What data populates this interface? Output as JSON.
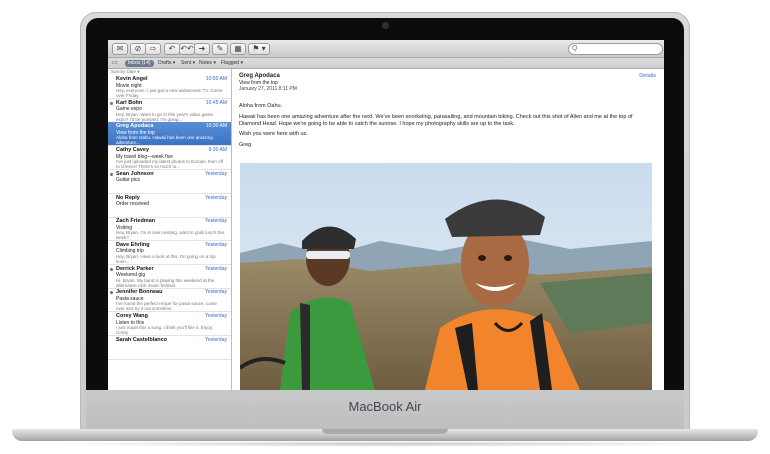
{
  "device_label": "MacBook Air",
  "toolbar": {
    "buttons": [
      "✉",
      "⊘",
      "⇨",
      "↶",
      "↶↶",
      "➜",
      "✎",
      "▦",
      "⚑ ▾"
    ],
    "search_placeholder": "Q"
  },
  "favorites": {
    "inbox": "Inbox (14)",
    "drafts": "Drafts ▾",
    "sent": "Sent ▾",
    "notes": "Notes ▾",
    "flagged": "Flagged ▾"
  },
  "list": {
    "sort_label": "Sort by Date ▾",
    "messages": [
      {
        "sender": "Kevin Angel",
        "date": "10:50 AM",
        "subject": "Movie night",
        "preview": "Hey, everyone. I just got a new widescreen TV. Come over Friday.",
        "unread": false,
        "selected": false
      },
      {
        "sender": "Karl Bohn",
        "date": "10:45 AM",
        "subject": "Game expo",
        "preview": "Hey, Bryan. Want to go to this year's video game expo? I'd be pumped, I'm going...",
        "unread": true,
        "selected": false
      },
      {
        "sender": "Greg Apodaca",
        "date": "10:30 AM",
        "subject": "View from the top",
        "preview": "Aloha from Oahu. Hawaii has been one amazing adventure...",
        "unread": false,
        "selected": true
      },
      {
        "sender": "Cathy Cavey",
        "date": "9:30 AM",
        "subject": "My travel blog—week five",
        "preview": "I've just uploaded my latest photos to Europe, then off to Greece! There's so much to...",
        "unread": false,
        "selected": false
      },
      {
        "sender": "Sean Johnson",
        "date": "Yesterday",
        "subject": "Guitar pics",
        "preview": "",
        "unread": true,
        "selected": false
      },
      {
        "sender": "No Reply",
        "date": "Yesterday",
        "subject": "Order received",
        "preview": "",
        "unread": false,
        "selected": false
      },
      {
        "sender": "Zach Friedman",
        "date": "Yesterday",
        "subject": "Visiting",
        "preview": "Hey, Bryan. I'm in town visiting, want to grab lunch this week?",
        "unread": false,
        "selected": false
      },
      {
        "sender": "Dave Ehrling",
        "date": "Yesterday",
        "subject": "Climbing trip",
        "preview": "Hey, Bryan. Have a look at this, I'm going on a trip soon...",
        "unread": false,
        "selected": false
      },
      {
        "sender": "Derrick Parker",
        "date": "Yesterday",
        "subject": "Weekend gig",
        "preview": "Hi, Bryan. My band is playing this weekend at the alternative rock music festival.",
        "unread": true,
        "selected": false
      },
      {
        "sender": "Jennifer Bonneau",
        "date": "Yesterday",
        "subject": "Pasta sauce",
        "preview": "I've found the perfect recipe for pasta sauce, come over and try it out sometime.",
        "unread": true,
        "selected": false
      },
      {
        "sender": "Corey Wang",
        "date": "Yesterday",
        "subject": "Listen to this",
        "preview": "I just made this a song. I think you'll like it. Enjoy, Corey",
        "unread": false,
        "selected": false
      },
      {
        "sender": "Sarah Castelblanco",
        "date": "Yesterday",
        "subject": "",
        "preview": "",
        "unread": false,
        "selected": false
      }
    ]
  },
  "reading": {
    "from": "Greg Apodaca",
    "subject": "View from the top",
    "date": "January 27, 2011 8:11 PM",
    "details_link": "Details",
    "greeting": "Aloha from Oahu.",
    "body": "Hawaii has been one amazing adventure after the next. We've been snorkeling, parasailing, and mountain biking. Check out this shot of Allen and me at the top of Diamond Head. Hope we're going to be able to catch the sunrise. I hope my photography skills are up to the task.",
    "closing": "Wish you were here with us.",
    "signature": "Greg"
  },
  "colors": {
    "selection": "#3b73c5",
    "link": "#2f6bcf",
    "unread_dot": "#3d7bd6"
  }
}
